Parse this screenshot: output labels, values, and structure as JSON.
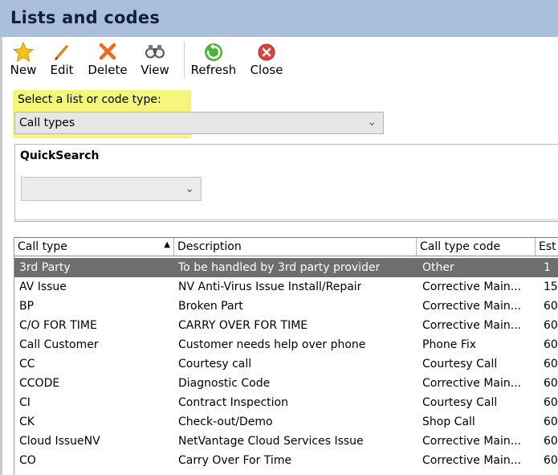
{
  "window": {
    "title": "Lists and codes"
  },
  "toolbar": {
    "new_label": "New",
    "edit_label": "Edit",
    "delete_label": "Delete",
    "view_label": "View",
    "refresh_label": "Refresh",
    "close_label": "Close"
  },
  "list_select": {
    "label": "Select a list or code type:",
    "value": "Call types"
  },
  "quicksearch": {
    "title": "QuickSearch",
    "value": ""
  },
  "grid": {
    "columns": [
      "Call type",
      "Description",
      "Call type code",
      "Est"
    ],
    "sorted_column": "Call type",
    "rows": [
      [
        "3rd Party",
        "To be handled by 3rd party provider",
        "Other",
        "1"
      ],
      [
        "AV Issue",
        "NV Anti-Virus Issue Install/Repair",
        "Corrective Main...",
        "15"
      ],
      [
        "BP",
        "Broken Part",
        "Corrective Main...",
        "60"
      ],
      [
        "C/O FOR TIME",
        "CARRY OVER FOR TIME",
        "Corrective Main...",
        "60"
      ],
      [
        "Call Customer",
        "Customer needs help over phone",
        "Phone Fix",
        "60"
      ],
      [
        "CC",
        "Courtesy call",
        "Courtesy Call",
        "60"
      ],
      [
        "CCODE",
        "Diagnostic Code",
        "Corrective Main...",
        "60"
      ],
      [
        "CI",
        "Contract Inspection",
        "Courtesy Call",
        "60"
      ],
      [
        "CK",
        "Check-out/Demo",
        "Shop Call",
        "60"
      ],
      [
        "Cloud IssueNV",
        "NetVantage Cloud Services Issue",
        "Corrective Main...",
        "60"
      ],
      [
        "CO",
        "Carry Over For Time",
        "Corrective Main...",
        "60"
      ]
    ],
    "selected_row": 0
  },
  "icons": {
    "new": "star-icon",
    "edit": "pencil-icon",
    "delete": "x-icon",
    "view": "binoculars-icon",
    "refresh": "refresh-icon",
    "close": "close-icon"
  },
  "colors": {
    "title_bar": "#a9bfdc",
    "highlight": "#f5f57a",
    "selected_row": "#6e6e6e"
  }
}
